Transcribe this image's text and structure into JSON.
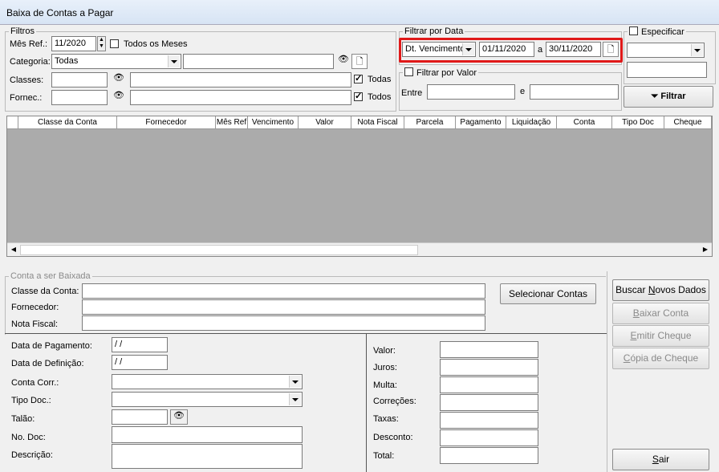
{
  "window": {
    "title": "Baixa de Contas a Pagar"
  },
  "filtros": {
    "legend": "Filtros",
    "mes_ref_label": "Mês Ref.:",
    "mes_ref_value": "11/2020",
    "todos_meses_label": "Todos os Meses",
    "categoria_label": "Categoria:",
    "categoria_value": "Todas",
    "classes_label": "Classes:",
    "fornec_label": "Fornec.:",
    "todos_label": "Todos",
    "todas_label": "Todas"
  },
  "filtrar_data": {
    "legend": "Filtrar por Data",
    "tipo_value": "Dt. Vencimento",
    "de_value": "01/11/2020",
    "a_label": "a",
    "ate_value": "30/11/2020"
  },
  "filtrar_valor": {
    "legend": "Filtrar por Valor",
    "entre_label": "Entre",
    "e_label": "e"
  },
  "especificar": {
    "label": "Especificar"
  },
  "filtrar_button": "Filtrar",
  "grid": {
    "columns": [
      "Classe da Conta",
      "Fornecedor",
      "Mês Ref",
      "Vencimento",
      "Valor",
      "Nota Fiscal",
      "Parcela",
      "Pagamento",
      "Liquidação",
      "Conta",
      "Tipo Doc",
      "Cheque"
    ]
  },
  "conta_baixada": {
    "legend": "Conta a ser Baixada",
    "classe_label": "Classe da Conta:",
    "fornecedor_label": "Fornecedor:",
    "nota_label": "Nota Fiscal:",
    "selecionar_button": "Selecionar Contas"
  },
  "form": {
    "data_pagamento_label": "Data de Pagamento:",
    "data_pagamento_value": " / /",
    "data_definicao_label": "Data de Definição:",
    "data_definicao_value": " / /",
    "conta_corr_label": "Conta Corr.:",
    "tipo_doc_label": "Tipo Doc.:",
    "talao_label": "Talão:",
    "no_doc_label": "No. Doc:",
    "descricao_label": "Descrição:",
    "valor_label": "Valor:",
    "juros_label": "Juros:",
    "multa_label": "Multa:",
    "correcoes_label": "Correções:",
    "taxas_label": "Taxas:",
    "desconto_label": "Desconto:",
    "total_label": "Total:"
  },
  "actions": {
    "buscar_pre": "Buscar ",
    "buscar_u": "N",
    "buscar_post": "ovos Dados",
    "baixar_u": "B",
    "baixar_post": "aixar Conta",
    "emitir_u": "E",
    "emitir_post": "mitir Cheque",
    "copia_u": "C",
    "copia_post": "ópia de Cheque",
    "sair_u": "S",
    "sair_post": "air"
  }
}
